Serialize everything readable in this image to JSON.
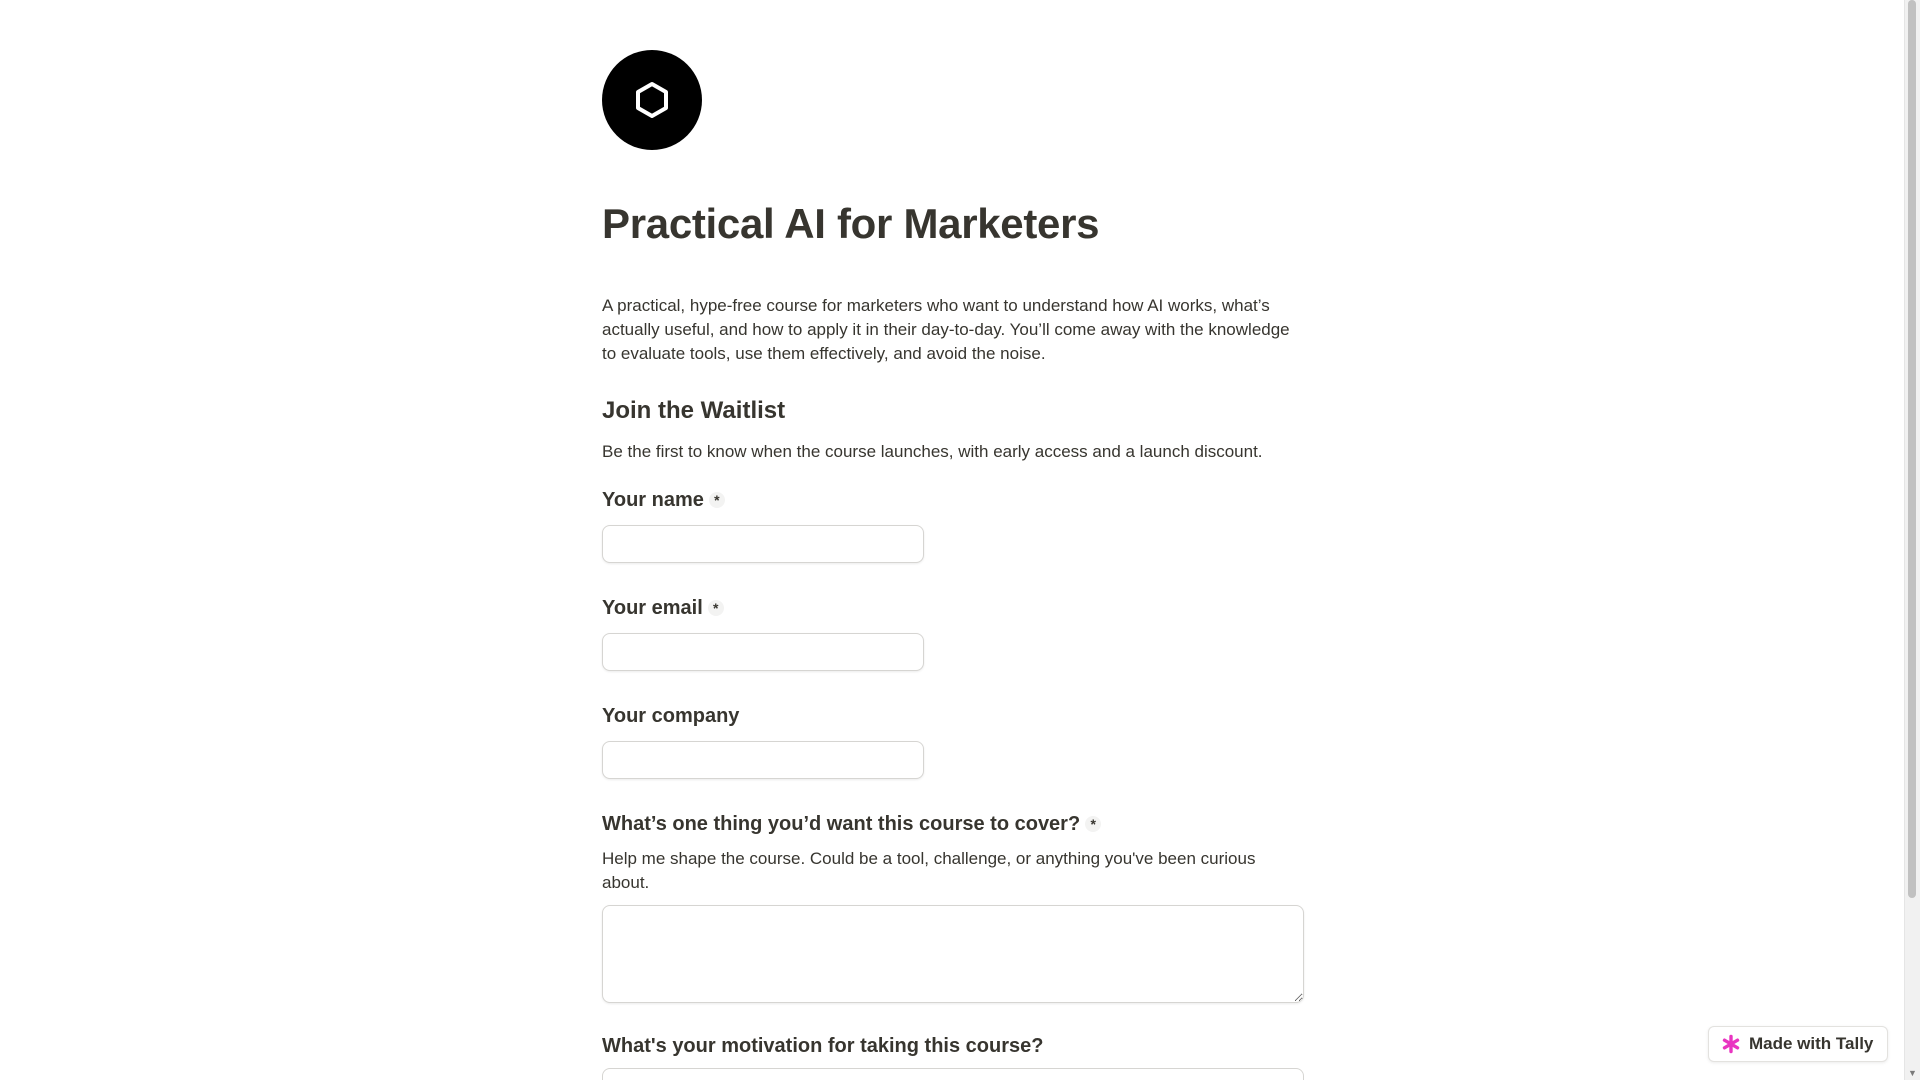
{
  "form": {
    "title": "Practical AI for Marketers",
    "intro": "A practical, hype-free course for marketers who want to understand how AI works, what’s actually useful, and how to apply it in their day-to-day. You’ll come away with the knowledge to evaluate tools, use them effectively, and avoid the noise.",
    "section_title": "Join the Waitlist",
    "section_desc": "Be the first to know when the course launches, with early access and a launch discount.",
    "required_marker": "*",
    "fields": {
      "name": {
        "label": "Your name",
        "value": ""
      },
      "email": {
        "label": "Your email",
        "value": ""
      },
      "company": {
        "label": "Your company",
        "value": ""
      },
      "cover": {
        "label": "What’s one thing you’d want this course to cover?",
        "help": "Help me shape the course. Could be a tool, challenge, or anything you've been curious about.",
        "value": ""
      },
      "motivation": {
        "label": "What's your motivation for taking this course?"
      }
    }
  },
  "badge": {
    "label": "Made with Tally",
    "icon": "tally-asterisk-icon",
    "icon_color": "#e935c1"
  },
  "logo": {
    "icon": "hexagon-icon",
    "background": "#000000"
  }
}
